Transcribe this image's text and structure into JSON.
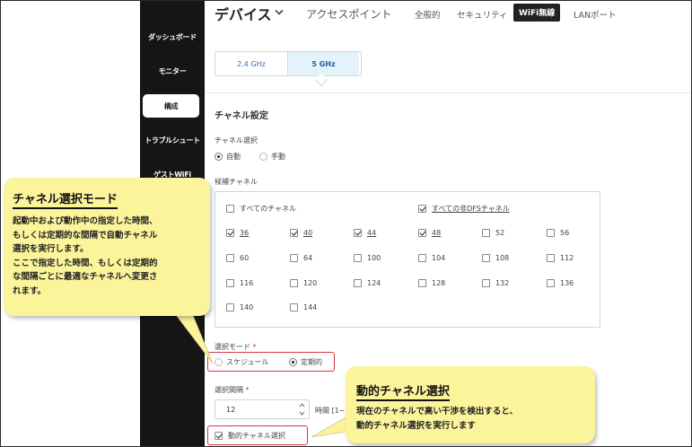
{
  "sidebar": {
    "items": [
      {
        "label": "ダッシュボード",
        "active": false
      },
      {
        "label": "モニター",
        "active": false
      },
      {
        "label": "構成",
        "active": true
      },
      {
        "label": "トラブルシュート",
        "active": false
      },
      {
        "label": "ゲストWiFi",
        "active": false
      }
    ]
  },
  "topnav": {
    "title": "デバイス",
    "tabs": [
      {
        "label": "アクセスポイント",
        "active": false
      },
      {
        "label": "全般的",
        "active": false
      },
      {
        "label": "セキュリティ",
        "active": false
      },
      {
        "label": "WiFi無線",
        "active": true
      },
      {
        "label": "LANポート",
        "active": false
      }
    ]
  },
  "freq_tabs": [
    {
      "label": "2.4 GHz",
      "selected": false
    },
    {
      "label": "5 GHz",
      "selected": true
    }
  ],
  "channel_settings": {
    "section_title": "チャネル設定",
    "selection_label": "チャネル選択",
    "selection_options": [
      {
        "label": "自動",
        "checked": true
      },
      {
        "label": "手動",
        "checked": false
      }
    ],
    "candidate_label": "候補チャネル",
    "all_channels_label": "すべてのチャネル",
    "all_channels_checked": false,
    "all_non_dfs_label": "すべての非DFSチャネル",
    "all_non_dfs_checked": true,
    "channels": [
      {
        "num": "36",
        "checked": true
      },
      {
        "num": "40",
        "checked": true
      },
      {
        "num": "44",
        "checked": true
      },
      {
        "num": "48",
        "checked": true
      },
      {
        "num": "52",
        "checked": false
      },
      {
        "num": "56",
        "checked": false
      },
      {
        "num": "60",
        "checked": false
      },
      {
        "num": "64",
        "checked": false
      },
      {
        "num": "100",
        "checked": false
      },
      {
        "num": "104",
        "checked": false
      },
      {
        "num": "108",
        "checked": false
      },
      {
        "num": "112",
        "checked": false
      },
      {
        "num": "116",
        "checked": false
      },
      {
        "num": "120",
        "checked": false
      },
      {
        "num": "124",
        "checked": false
      },
      {
        "num": "128",
        "checked": false
      },
      {
        "num": "132",
        "checked": false
      },
      {
        "num": "136",
        "checked": false
      },
      {
        "num": "140",
        "checked": false
      },
      {
        "num": "144",
        "checked": false
      }
    ],
    "mode_label": "選択モード",
    "mode_options": [
      {
        "label": "スケジュール",
        "checked": false
      },
      {
        "label": "定期的",
        "checked": true
      }
    ],
    "interval_label": "選択間隔",
    "interval_value": "12",
    "interval_unit": "時間 [1~",
    "dynamic_label": "動的チャネル選択",
    "dynamic_checked": true,
    "required_mark": "*"
  },
  "callouts": {
    "mode": {
      "title": "チャネル選択モード",
      "lines": [
        "起動中および動作中の指定した時間、",
        "もしくは定期的な間隔で自動チャネル",
        "選択を実行します。",
        "ここで指定した時間、もしくは定期的",
        "な間隔ごとに最適なチャネルへ変更さ",
        "れます。"
      ]
    },
    "dynamic": {
      "title": "動的チャネル選択",
      "lines": [
        "現在のチャネルで高い干渉を検出すると、",
        "動的チャネル選択を実行します"
      ]
    }
  },
  "colors": {
    "sidebar_bg": "#151515",
    "accent_blue": "#3a6ea5",
    "callout_bg": "#fbf49b",
    "highlight_red": "#d9343f"
  },
  "icons": {
    "title_dropdown": "chevron-down-icon",
    "stepper": "stepper-arrows-icon"
  }
}
